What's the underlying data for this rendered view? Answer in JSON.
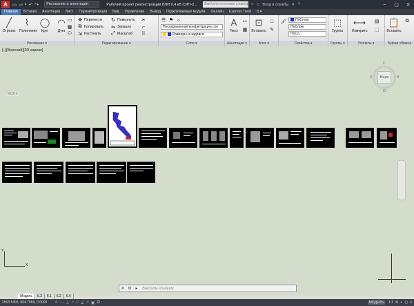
{
  "titlebar": {
    "app_logo": "A",
    "workspace": "Рисование и аннотации",
    "title": "Рабочий проект реконструкции ВЛИ 0,4 кВ СИП-2...",
    "search_placeholder": "Введите ключевое слово/фразу",
    "signin": "Вход в службы",
    "icons": [
      "new-icon",
      "open-icon",
      "save-icon",
      "undo-icon",
      "redo-icon",
      "search-icon",
      "help-icon"
    ]
  },
  "tabs": [
    {
      "label": "Главная",
      "active": true
    },
    {
      "label": "Вставка"
    },
    {
      "label": "Аннотации"
    },
    {
      "label": "Лист"
    },
    {
      "label": "Параметризация"
    },
    {
      "label": "Вид"
    },
    {
      "label": "Управление"
    },
    {
      "label": "Вывод"
    },
    {
      "label": "Подключаемые модули"
    },
    {
      "label": "Онлайн"
    },
    {
      "label": "Express Tools"
    },
    {
      "label": "◘ ▾"
    }
  ],
  "ribbon": {
    "draw": {
      "title": "Рисование ▾",
      "line": "Отрезок",
      "polyline": "Полилиния",
      "circle": "Круг",
      "arc": "Дуга"
    },
    "modify": {
      "title": "Редактирование ▾",
      "move": "Перенести",
      "copy": "Копировать",
      "stretch": "Растянуть",
      "rotate": "Повернуть",
      "mirror": "Зеркало",
      "scale": "Масштаб"
    },
    "layers": {
      "title": "Слои ▾",
      "state": "Несохраненная конфигурация сло",
      "current": "Размеры и надписи"
    },
    "annotation": {
      "title": "Аннотации ▾",
      "text": "Текст"
    },
    "block": {
      "title": "Блок ▾",
      "insert": "Вставить"
    },
    "properties": {
      "title": "Свойства ▾",
      "color": "ПоСлою",
      "linetype": "ПоСлою",
      "lineweight": "ПоСл..."
    },
    "groups": {
      "title": "Группы ▾",
      "group": "Группа"
    },
    "utilities": {
      "title": "Утилиты ▾",
      "measure": "Измерить"
    },
    "clipboard": {
      "title": "Буфер обмена",
      "paste": "Вставить"
    }
  },
  "canvas": {
    "viewport_label": "[–][Верхний][2D каркас]",
    "viewcube": {
      "face": "Верх",
      "north": "С",
      "south": "Ю",
      "west": "З",
      "east": "В",
      "wcs": "МСК ▾"
    },
    "ucs": {
      "x": "X",
      "y": "Y"
    }
  },
  "cmdline": {
    "placeholder": "Введите команду"
  },
  "layout_tabs": [
    "Модель",
    "6.3",
    "6.1",
    "6.2",
    "6.4"
  ],
  "status": {
    "coords": "2563.5491, 904.7969, 0.0000",
    "mode": "МОДЕЛЬ",
    "scale": "1:1",
    "icons": [
      "grid-icon",
      "snap-icon",
      "ortho-icon",
      "polar-icon",
      "osnap-icon",
      "otrack-icon",
      "lineweight-icon"
    ]
  },
  "colors": {
    "titlebar": "#2b2f36",
    "active_tab": "#4a78b8",
    "canvas": "#d4dccc"
  }
}
